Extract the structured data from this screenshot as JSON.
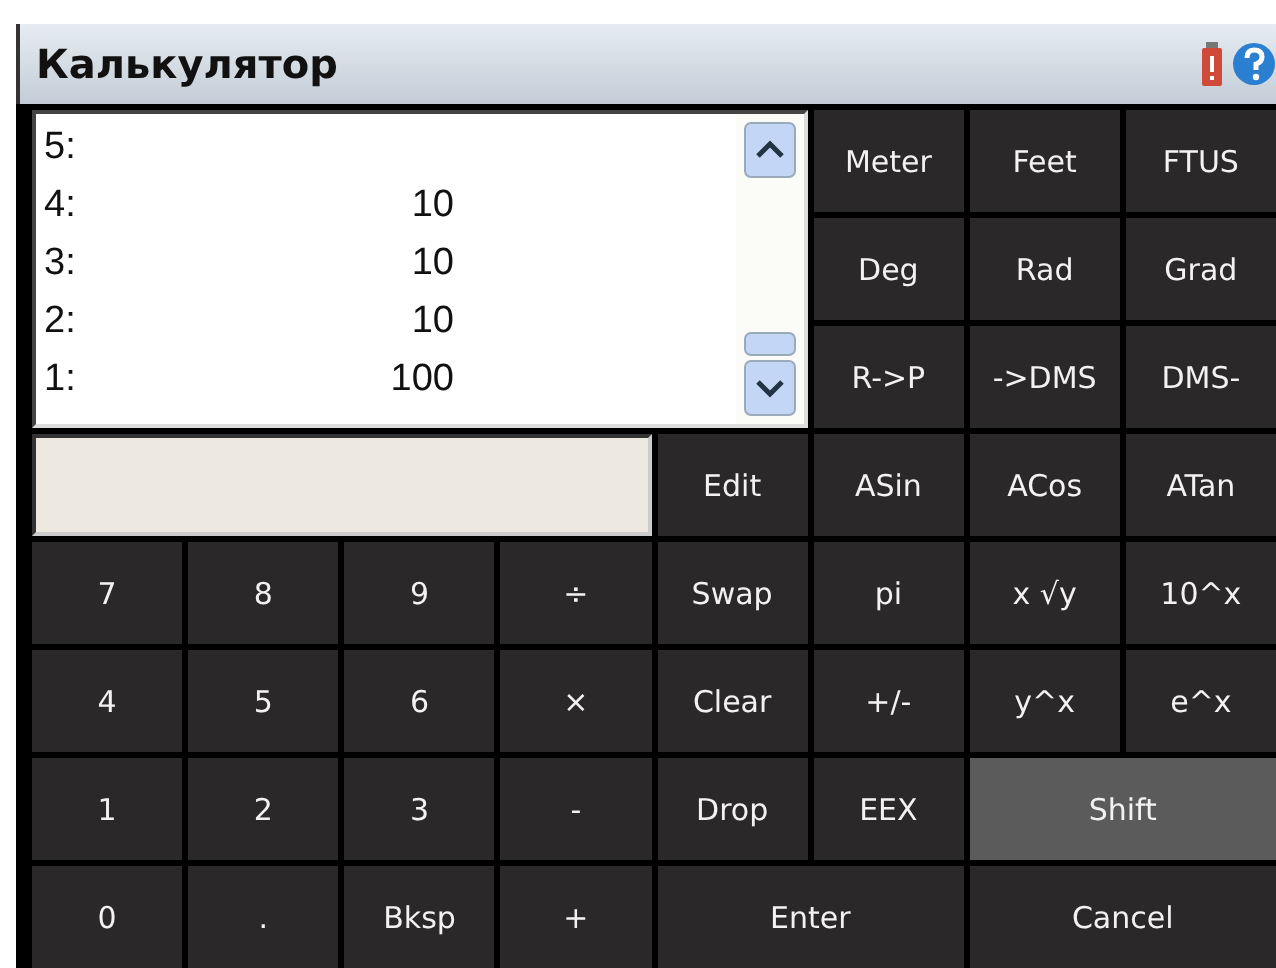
{
  "window": {
    "title": "Калькулятор"
  },
  "stack": [
    {
      "label": "5:"
    },
    {
      "label": "4:",
      "value": "10"
    },
    {
      "label": "3:",
      "value": "10"
    },
    {
      "label": "2:",
      "value": "10"
    },
    {
      "label": "1:",
      "value": "100"
    }
  ],
  "keys": [
    {
      "label": "Meter",
      "kind": "normal",
      "pressed": false
    },
    {
      "label": "Feet",
      "kind": "normal",
      "pressed": false
    },
    {
      "label": "FTUS",
      "kind": "normal",
      "pressed": false
    },
    {
      "label": "Deg",
      "kind": "normal",
      "pressed": false
    },
    {
      "label": "Rad",
      "kind": "normal",
      "pressed": false
    },
    {
      "label": "Grad",
      "kind": "normal",
      "pressed": false
    },
    {
      "label": "R->P",
      "kind": "normal",
      "pressed": false
    },
    {
      "label": "->DMS",
      "kind": "normal",
      "pressed": false
    },
    {
      "label": "DMS-",
      "kind": "normal",
      "pressed": false
    },
    {
      "label": "Edit",
      "kind": "normal",
      "pressed": false
    },
    {
      "label": "ASin",
      "kind": "normal",
      "pressed": false
    },
    {
      "label": "ACos",
      "kind": "normal",
      "pressed": false
    },
    {
      "label": "ATan",
      "kind": "normal",
      "pressed": false
    },
    {
      "label": "7",
      "kind": "normal",
      "pressed": false
    },
    {
      "label": "8",
      "kind": "normal",
      "pressed": false
    },
    {
      "label": "9",
      "kind": "normal",
      "pressed": false
    },
    {
      "label": "÷",
      "kind": "normal",
      "pressed": false
    },
    {
      "label": "Swap",
      "kind": "normal",
      "pressed": false
    },
    {
      "label": "pi",
      "kind": "normal",
      "pressed": false
    },
    {
      "label": "x √y",
      "kind": "normal",
      "pressed": false
    },
    {
      "label": "10^x",
      "kind": "normal",
      "pressed": false
    },
    {
      "label": "4",
      "kind": "normal",
      "pressed": false
    },
    {
      "label": "5",
      "kind": "normal",
      "pressed": false
    },
    {
      "label": "6",
      "kind": "normal",
      "pressed": false
    },
    {
      "label": "×",
      "kind": "normal",
      "pressed": false
    },
    {
      "label": "Clear",
      "kind": "normal",
      "pressed": false
    },
    {
      "label": "+/-",
      "kind": "normal",
      "pressed": false
    },
    {
      "label": "y^x",
      "kind": "normal",
      "pressed": false
    },
    {
      "label": "e^x",
      "kind": "normal",
      "pressed": false
    },
    {
      "label": "1",
      "kind": "normal",
      "pressed": false
    },
    {
      "label": "2",
      "kind": "normal",
      "pressed": false
    },
    {
      "label": "3",
      "kind": "normal",
      "pressed": false
    },
    {
      "label": "-",
      "kind": "normal",
      "pressed": false
    },
    {
      "label": "Drop",
      "kind": "normal",
      "pressed": false
    },
    {
      "label": "EEX",
      "kind": "normal",
      "pressed": false
    },
    {
      "label": "Shift",
      "kind": "wide",
      "pressed": true
    },
    {
      "label": "0",
      "kind": "normal",
      "pressed": false
    },
    {
      "label": ".",
      "kind": "normal",
      "pressed": false
    },
    {
      "label": "Bksp",
      "kind": "normal",
      "pressed": false
    },
    {
      "label": "+",
      "kind": "normal",
      "pressed": false
    },
    {
      "label": "Enter",
      "kind": "wide",
      "pressed": false
    },
    {
      "label": "Cancel",
      "kind": "wide",
      "pressed": false
    }
  ]
}
